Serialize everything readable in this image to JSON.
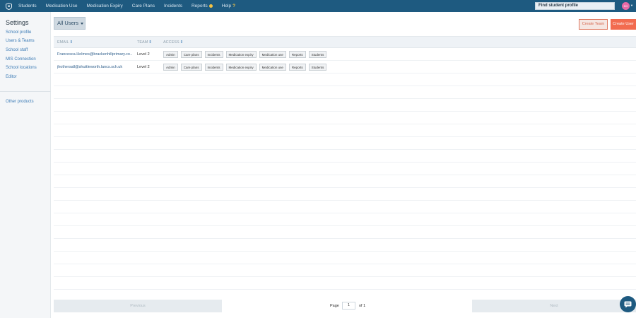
{
  "nav": {
    "items": [
      "Students",
      "Medication Use",
      "Medication Expiry",
      "Care Plans",
      "Incidents",
      "Reports",
      "Help"
    ],
    "search_placeholder": "Find student profile",
    "avatar_initials": "DH"
  },
  "sidebar": {
    "title": "Settings",
    "links": [
      "School profile",
      "Users & Teams",
      "School staff",
      "MIS Connection",
      "School locations",
      "Editor"
    ],
    "other": "Other products"
  },
  "main": {
    "filter_label": "All Users",
    "create_team": "Create Team",
    "create_user": "Create User",
    "columns": [
      "EMAIL",
      "TEAM",
      "ACCESS"
    ],
    "rows": [
      {
        "email": "Francesca.Holmes@brackenhillprimary.co…",
        "team": "Level 2",
        "access": [
          "Admin",
          "Care plans",
          "Incidents",
          "Medication expiry",
          "Medication use",
          "Reports",
          "Students"
        ]
      },
      {
        "email": "jhothersall@shuttleworth.lancs.sch.uk",
        "team": "Level 2",
        "access": [
          "Admin",
          "Care plans",
          "Incidents",
          "Medication expiry",
          "Medication use",
          "Reports",
          "Students"
        ]
      }
    ]
  },
  "pagination": {
    "previous": "Previous",
    "page_label": "Page",
    "page_value": "1",
    "of_label": "of 1",
    "next": "Next"
  },
  "colors": {
    "nav": "#1e5a80",
    "accent": "#f26b4f",
    "link": "#3a7ab5"
  }
}
